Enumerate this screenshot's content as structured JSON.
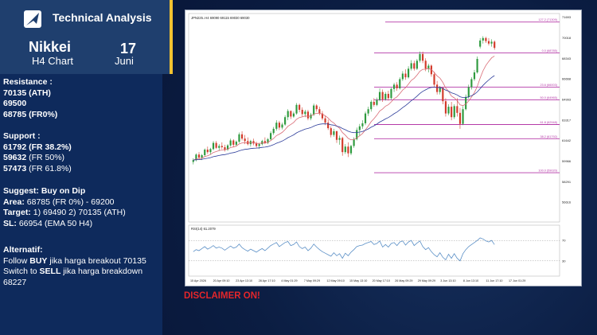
{
  "brand": {
    "name": "Technical Analysis",
    "logo_icon": "arrow-logo-icon"
  },
  "title": {
    "instrument": "Nikkei",
    "timeframe": "H4 Chart",
    "day": "17",
    "month": "Juni"
  },
  "resistance": {
    "heading": "Resistance :",
    "levels": [
      "70135 (ATH)",
      "69500",
      "68785 (FR0%)"
    ]
  },
  "support": {
    "heading": "Support :",
    "levels": [
      {
        "value": "61792",
        "note": "(FR 38.2%)"
      },
      {
        "value": "59632",
        "note": "(FR 50%)"
      },
      {
        "value": "57473",
        "note": "(FR 61.8%)"
      }
    ]
  },
  "suggest": {
    "heading": "Suggest: Buy on Dip",
    "area_label": "Area:",
    "area_value": "68785 (FR 0%) - 69200",
    "target_label": "Target:",
    "target_value": "1) 69490 2) 70135 (ATH)",
    "sl_label": "SL:",
    "sl_value": "66954 (EMA 50 H4)"
  },
  "alternatif": {
    "heading": "Alternatif:",
    "line1_pre": "Follow",
    "line1_bold": "BUY",
    "line1_post": "jika harga breakout 70135",
    "line2_pre": "Switch to",
    "line2_bold": "SELL",
    "line2_post": "jika harga breakdown",
    "line3": "68227"
  },
  "disclaimer": "DISCLAIMER ON!",
  "colors": {
    "accent": "#f2c230",
    "bull": "#2e9a3e",
    "bear": "#d23a2a",
    "fib_line": "#b53aa8",
    "ema_fast": "#d96a74",
    "ema_slow": "#2d3d9a",
    "rsi_line": "#5a8fc6",
    "disclaimer": "#e3262b"
  },
  "chart_data": {
    "type": "candlestick",
    "symbol_header": "JPN225..H4  69090 69115 69030 69030",
    "ylim": [
      55000,
      72000
    ],
    "y_ticks": [
      56616,
      58291,
      59966,
      61642,
      63317,
      64993,
      66668,
      68343,
      70018,
      71693
    ],
    "x_ticks": [
      "15 Apr 2026",
      "20 Apr 09:10",
      "23 Apr 13:10",
      "28 Apr 17:10",
      "4 May 01:29",
      "7 May 09:29",
      "12 May 09:10",
      "15 May 13:10",
      "20 May 17:10",
      "26 May 09:29",
      "29 May 09:29",
      "3 Jun 13:10",
      "8 Jun 13:10",
      "11 Jun 17:10",
      "17 Jun 01:29"
    ],
    "fib_levels": [
      {
        "label": "127.2 (71309)",
        "value": 71309
      },
      {
        "label": "0.0 (68785)",
        "value": 68785
      },
      {
        "label": "23.6 (66003)",
        "value": 66003
      },
      {
        "label": "38.2 (61792)",
        "value": 61792
      },
      {
        "label": "50.0 (64965)",
        "value": 64965
      },
      {
        "label": "61.8 (62948)",
        "value": 62948
      },
      {
        "label": "100.0 (59020)",
        "value": 59020
      }
    ],
    "candles": [
      [
        59900,
        60200,
        59700,
        60050
      ],
      [
        60050,
        60600,
        59950,
        60500
      ],
      [
        60500,
        60700,
        60100,
        60250
      ],
      [
        60250,
        60550,
        60050,
        60450
      ],
      [
        60450,
        61000,
        60350,
        60900
      ],
      [
        60900,
        61150,
        60550,
        60700
      ],
      [
        60700,
        61050,
        60500,
        60950
      ],
      [
        60950,
        61600,
        60850,
        61450
      ],
      [
        61450,
        61600,
        60950,
        61050
      ],
      [
        61050,
        61350,
        60800,
        61200
      ],
      [
        61200,
        61500,
        60950,
        61100
      ],
      [
        61100,
        61300,
        60750,
        60900
      ],
      [
        60900,
        61350,
        60800,
        61250
      ],
      [
        61250,
        61800,
        61150,
        61650
      ],
      [
        61650,
        61750,
        61100,
        61300
      ],
      [
        61300,
        61650,
        61150,
        61550
      ],
      [
        61550,
        62300,
        61450,
        62150
      ],
      [
        62150,
        62400,
        61650,
        61800
      ],
      [
        61800,
        62100,
        61350,
        61600
      ],
      [
        61600,
        61900,
        61250,
        61350
      ],
      [
        61350,
        61700,
        61150,
        61600
      ],
      [
        61600,
        61800,
        61250,
        61400
      ],
      [
        61400,
        61550,
        61050,
        61200
      ],
      [
        61200,
        61450,
        60950,
        61350
      ],
      [
        61350,
        61700,
        61250,
        61600
      ],
      [
        61600,
        61900,
        61350,
        61450
      ],
      [
        61450,
        61850,
        61350,
        61750
      ],
      [
        61750,
        62400,
        61650,
        62250
      ],
      [
        62250,
        62750,
        62100,
        62600
      ],
      [
        62600,
        63300,
        62450,
        63100
      ],
      [
        63100,
        63250,
        62500,
        62700
      ],
      [
        62700,
        63100,
        62550,
        62950
      ],
      [
        62950,
        63700,
        62850,
        63550
      ],
      [
        63550,
        64200,
        63300,
        64050
      ],
      [
        64050,
        64100,
        63400,
        63600
      ],
      [
        63600,
        64000,
        63500,
        63850
      ],
      [
        63850,
        64700,
        63750,
        64550
      ],
      [
        64550,
        64650,
        63950,
        64150
      ],
      [
        64150,
        64350,
        63600,
        63800
      ],
      [
        63800,
        64150,
        63550,
        64000
      ],
      [
        64000,
        64150,
        63300,
        63450
      ],
      [
        63450,
        63900,
        63300,
        63750
      ],
      [
        63750,
        64650,
        63650,
        64500
      ],
      [
        64500,
        64600,
        64000,
        64200
      ],
      [
        64200,
        64400,
        63700,
        63850
      ],
      [
        63850,
        64050,
        63300,
        63450
      ],
      [
        63450,
        63650,
        62900,
        63100
      ],
      [
        63100,
        63350,
        62500,
        62650
      ],
      [
        62650,
        62800,
        61900,
        62100
      ],
      [
        62100,
        62600,
        61950,
        62400
      ],
      [
        62400,
        62450,
        61450,
        61700
      ],
      [
        61700,
        62050,
        61300,
        61850
      ],
      [
        61850,
        61950,
        60400,
        60700
      ],
      [
        60700,
        61350,
        60550,
        61150
      ],
      [
        61150,
        61500,
        60300,
        60600
      ],
      [
        60600,
        61300,
        60450,
        61200
      ],
      [
        61200,
        61900,
        61050,
        61750
      ],
      [
        61750,
        62700,
        61650,
        62500
      ],
      [
        62500,
        63000,
        62000,
        62800
      ],
      [
        62800,
        63300,
        62600,
        63050
      ],
      [
        63050,
        64000,
        62900,
        63850
      ],
      [
        63850,
        64400,
        63650,
        64200
      ],
      [
        64200,
        64950,
        64000,
        64800
      ],
      [
        64800,
        65100,
        64400,
        64550
      ],
      [
        64550,
        65150,
        64450,
        64950
      ],
      [
        64950,
        65900,
        64850,
        65600
      ],
      [
        65600,
        65800,
        64800,
        65000
      ],
      [
        65000,
        65600,
        64900,
        65450
      ],
      [
        65450,
        65700,
        64900,
        65100
      ],
      [
        65100,
        65950,
        65000,
        65850
      ],
      [
        65850,
        66350,
        65600,
        66200
      ],
      [
        66200,
        66400,
        65700,
        65900
      ],
      [
        65900,
        66800,
        65800,
        66650
      ],
      [
        66650,
        67300,
        66500,
        67100
      ],
      [
        67100,
        67450,
        66600,
        66800
      ],
      [
        66800,
        67700,
        66700,
        67500
      ],
      [
        67500,
        68200,
        67350,
        67950
      ],
      [
        67950,
        68150,
        67350,
        67500
      ],
      [
        67500,
        68300,
        67400,
        68150
      ],
      [
        68150,
        68900,
        68000,
        68700
      ],
      [
        68700,
        68900,
        67950,
        68150
      ],
      [
        68150,
        68350,
        67300,
        67500
      ],
      [
        67500,
        67900,
        67200,
        67750
      ],
      [
        67750,
        67850,
        66850,
        67050
      ],
      [
        67050,
        67250,
        66000,
        66200
      ],
      [
        66200,
        66500,
        65400,
        65600
      ],
      [
        65600,
        66100,
        65400,
        65950
      ],
      [
        65950,
        66000,
        64600,
        64850
      ],
      [
        64850,
        65100,
        63600,
        63850
      ],
      [
        63850,
        64600,
        63700,
        64400
      ],
      [
        64400,
        64800,
        63300,
        63550
      ],
      [
        63550,
        64600,
        63400,
        64450
      ],
      [
        64450,
        65100,
        63600,
        63900
      ],
      [
        63900,
        64300,
        62600,
        63000
      ],
      [
        63000,
        64450,
        62900,
        64200
      ],
      [
        64200,
        65400,
        64100,
        65200
      ],
      [
        65200,
        66200,
        65050,
        66000
      ],
      [
        66000,
        66800,
        65800,
        66650
      ],
      [
        66650,
        67400,
        66500,
        67200
      ],
      [
        67200,
        68500,
        67100,
        68300
      ],
      [
        69300,
        70000,
        69150,
        69800
      ],
      [
        69800,
        70150,
        69550,
        70000
      ],
      [
        70000,
        70100,
        69600,
        69750
      ],
      [
        69750,
        70000,
        69400,
        69550
      ],
      [
        69550,
        69900,
        69300,
        69700
      ],
      [
        69700,
        69800,
        69050,
        69200
      ]
    ],
    "indicators": [
      {
        "name": "EMA fast",
        "color": "#d96a74"
      },
      {
        "name": "EMA slow",
        "color": "#2d3d9a"
      }
    ],
    "rsi": {
      "label": "RSI(14) 61.2079",
      "ylim": [
        0,
        100
      ],
      "ticks": [
        70,
        30
      ],
      "values": [
        48,
        52,
        50,
        54,
        58,
        53,
        56,
        60,
        55,
        57,
        55,
        51,
        55,
        59,
        55,
        57,
        63,
        56,
        52,
        49,
        53,
        50,
        47,
        51,
        54,
        50,
        55,
        60,
        63,
        66,
        58,
        62,
        66,
        68,
        60,
        62,
        67,
        58,
        54,
        57,
        50,
        55,
        63,
        57,
        52,
        48,
        45,
        42,
        39,
        46,
        40,
        44,
        35,
        45,
        40,
        47,
        52,
        58,
        60,
        61,
        64,
        66,
        68,
        62,
        64,
        69,
        57,
        62,
        57,
        64,
        66,
        60,
        67,
        69,
        61,
        67,
        70,
        60,
        65,
        69,
        58,
        52,
        56,
        48,
        42,
        38,
        46,
        37,
        32,
        43,
        35,
        44,
        35,
        30,
        44,
        52,
        58,
        62,
        66,
        70,
        75,
        73,
        69,
        67,
        70,
        62
      ]
    }
  }
}
